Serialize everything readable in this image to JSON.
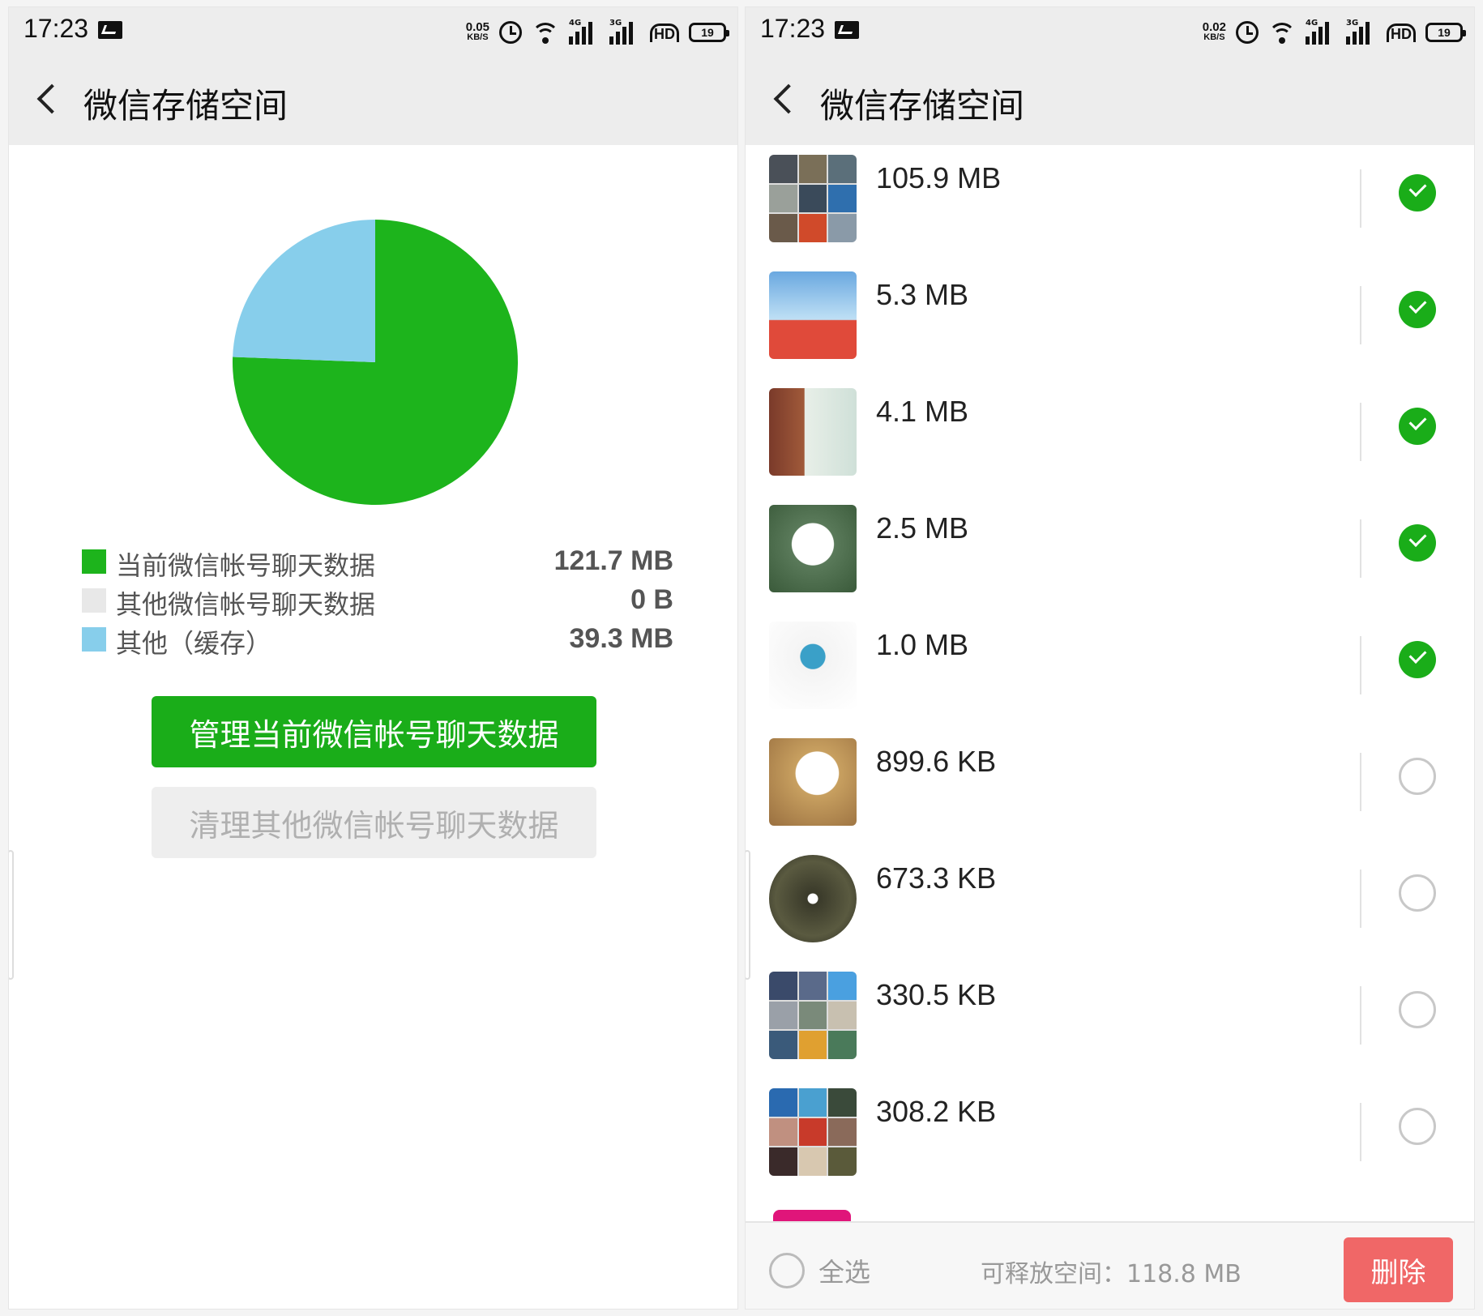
{
  "status_bar": {
    "left": {
      "time": "17:23",
      "net_speed": "0.05",
      "net_unit": "KB/S",
      "battery": "19"
    },
    "right": {
      "time": "17:23",
      "net_speed": "0.02",
      "net_unit": "KB/S",
      "battery": "19"
    },
    "signal_tags": [
      "4G",
      "3G"
    ],
    "hd_label": "HD"
  },
  "storage_screen": {
    "title": "微信存储空间",
    "chart_data": {
      "type": "pie",
      "slices": [
        {
          "label": "当前微信帐号聊天数据",
          "value": 121.7,
          "display": "121.7 MB",
          "color": "#1db41c"
        },
        {
          "label": "其他微信帐号聊天数据",
          "value": 0,
          "display": "0 B",
          "color": "#e8e8e8"
        },
        {
          "label": "其他（缓存）",
          "value": 39.3,
          "display": "39.3 MB",
          "color": "#87ceeb"
        }
      ],
      "unit": "MB"
    },
    "manage_button": "管理当前微信帐号聊天数据",
    "clean_button": "清理其他微信帐号聊天数据"
  },
  "manage_screen": {
    "title": "微信存储空间",
    "items": [
      {
        "size": "105.9 MB",
        "checked": true
      },
      {
        "size": "5.3 MB",
        "checked": true
      },
      {
        "size": "4.1 MB",
        "checked": true
      },
      {
        "size": "2.5 MB",
        "checked": true
      },
      {
        "size": "1.0 MB",
        "checked": true
      },
      {
        "size": "899.6 KB",
        "checked": false
      },
      {
        "size": "673.3 KB",
        "checked": false
      },
      {
        "size": "330.5 KB",
        "checked": false
      },
      {
        "size": "308.2 KB",
        "checked": false
      }
    ],
    "select_all": "全选",
    "free_space": "可释放空间：118.8 MB",
    "delete_button": "删除"
  },
  "colors": {
    "accent": "#1aad19",
    "delete": "#f06767"
  }
}
